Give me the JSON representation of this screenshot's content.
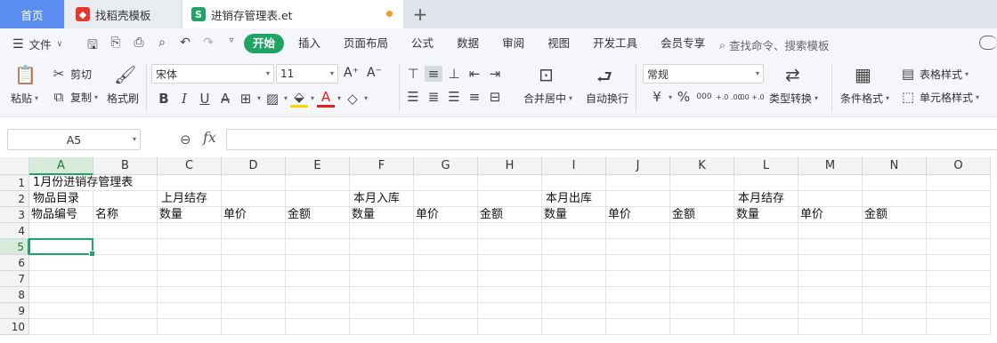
{
  "tabs": {
    "home": "首页",
    "daoke": "找稻壳模板",
    "file": "进销存管理表.et",
    "add": "+"
  },
  "menu": {
    "file_label": "文件",
    "tabs": [
      "开始",
      "插入",
      "页面布局",
      "公式",
      "数据",
      "审阅",
      "视图",
      "开发工具",
      "会员专享"
    ],
    "active_tab": "开始",
    "search_placeholder": "查找命令、搜索模板"
  },
  "ribbon": {
    "paste": "粘贴",
    "cut": "剪切",
    "copy": "复制",
    "format_painter": "格式刷",
    "font_name": "宋体",
    "font_size": "11",
    "bold": "B",
    "italic": "I",
    "underline": "U",
    "merge_center": "合并居中",
    "wrap_text": "自动换行",
    "number_format": "常规",
    "type_convert": "类型转换",
    "conditional_format": "条件格式",
    "table_style": "表格样式",
    "cell_style": "单元格样式",
    "currency": "¥",
    "percent": "%",
    "thousands": "000",
    "inc_decimal": "+.0 .00",
    "dec_decimal": ".00 +.0"
  },
  "formula_bar": {
    "name_box": "A5",
    "fx": "fx",
    "value": ""
  },
  "sheet": {
    "columns": [
      "A",
      "B",
      "C",
      "D",
      "E",
      "F",
      "G",
      "H",
      "I",
      "J",
      "K",
      "L",
      "M",
      "N",
      "O"
    ],
    "rows": [
      "1",
      "2",
      "3",
      "4",
      "5",
      "6",
      "7",
      "8",
      "9",
      "10"
    ],
    "selected_cell": "A5",
    "r1": {
      "a": "1月份进销存管理表"
    },
    "r2": {
      "a": "物品目录",
      "c": "上月结存",
      "f": "本月入库",
      "i": "本月出库",
      "l": "本月结存"
    },
    "r3": [
      "物品编号",
      "名称",
      "数量",
      "单价",
      "金额",
      "数量",
      "单价",
      "金额",
      "数量",
      "单价",
      "金额",
      "数量",
      "单价",
      "金额",
      ""
    ]
  }
}
